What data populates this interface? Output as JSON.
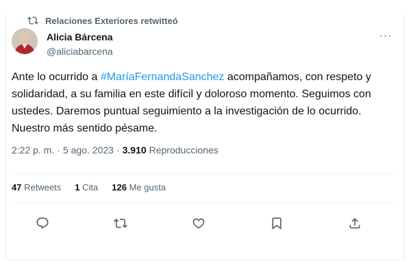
{
  "retweet": {
    "text": "Relaciones Exteriores retwitteó"
  },
  "author": {
    "name": "Alicia Bárcena",
    "handle": "@aliciabarcena"
  },
  "more_label": "···",
  "tweet": {
    "part1": "Ante lo ocurrido a ",
    "hashtag": "#MaríaFernandaSanchez",
    "part2": " acompañamos, con respeto y solidaridad, a su familia en este difícil y doloroso momento. Seguimos con ustedes. Daremos puntual seguimiento a la investigación de lo ocurrido. Nuestro más sentido pésame."
  },
  "meta": {
    "time": "2:22 p. m.",
    "separator": "·",
    "date": "5 ago. 2023",
    "views_count": "3.910",
    "views_label": "Reproducciones"
  },
  "stats": {
    "retweets_count": "47",
    "retweets_label": "Retweets",
    "quotes_count": "1",
    "quotes_label": "Cita",
    "likes_count": "126",
    "likes_label": "Me gusta"
  },
  "actions": [
    "reply-icon",
    "retweet-icon",
    "like-icon",
    "bookmark-icon",
    "share-icon"
  ],
  "colors": {
    "accent": "#1d9bf0",
    "secondary_text": "#536471",
    "primary_text": "#0f1419"
  }
}
